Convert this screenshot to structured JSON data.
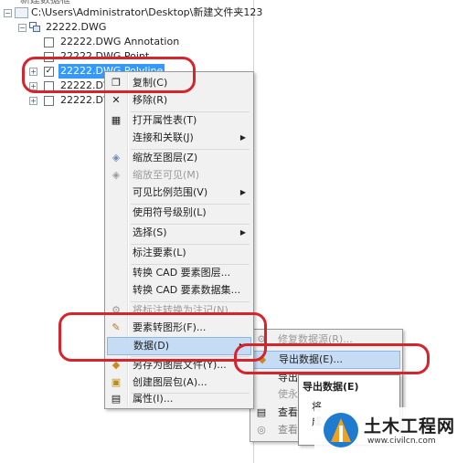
{
  "tree": {
    "top_partial": "新建数据框",
    "folder_path": "C:\\Users\\Administrator\\Desktop\\新建文件夹123",
    "dataset": "22222.DWG",
    "layers": [
      "22222.DWG Annotation",
      "22222.DWG Point",
      "22222.DWG Polyline",
      "22222.DWG",
      "22222.DWG"
    ]
  },
  "context_menu": {
    "items": [
      {
        "label": "复制(C)",
        "icon": "copy-icon"
      },
      {
        "label": "移除(R)",
        "icon": "remove-x-icon"
      },
      {
        "label": "打开属性表(T)",
        "icon": "table-icon"
      },
      {
        "label": "连接和关联(J)",
        "submenu": true
      },
      {
        "label": "缩放至图层(Z)",
        "icon": "zoom-layer-icon"
      },
      {
        "label": "缩放至可见(M)",
        "icon": "zoom-visible-icon",
        "disabled": true
      },
      {
        "label": "可见比例范围(V)",
        "submenu": true
      },
      {
        "label": "使用符号级别(L)"
      },
      {
        "label": "选择(S)",
        "submenu": true
      },
      {
        "label": "标注要素(L)"
      },
      {
        "label": "转换 CAD 要素图层..."
      },
      {
        "label": "转换 CAD 要素数据集..."
      },
      {
        "label": "将标注转换为注记(N)...",
        "disabled": true
      },
      {
        "label": "要素转图形(F)..."
      },
      {
        "label": "数据(D)",
        "submenu": true
      },
      {
        "label": "另存为图层文件(Y)..."
      },
      {
        "label": "创建图层包(A)..."
      },
      {
        "label": "属性(I)..."
      }
    ]
  },
  "data_submenu": {
    "items": [
      {
        "label": "修复数据源(R)...",
        "disabled": true
      },
      {
        "label": "导出数据(E)..."
      },
      {
        "label": "导出"
      },
      {
        "label": "使永"
      },
      {
        "label": "查看"
      },
      {
        "label": "查看元数据"
      }
    ]
  },
  "tooltip": {
    "title": "导出数据(E)",
    "body_line1": "将",
    "body_line2": "成"
  },
  "watermark": {
    "text": "土木工程网",
    "url": "www.civilcn.com"
  },
  "colors": {
    "highlight_red": "#d6242c",
    "selection_blue": "#3399ff",
    "menu_hover": "#c6dbf4"
  }
}
